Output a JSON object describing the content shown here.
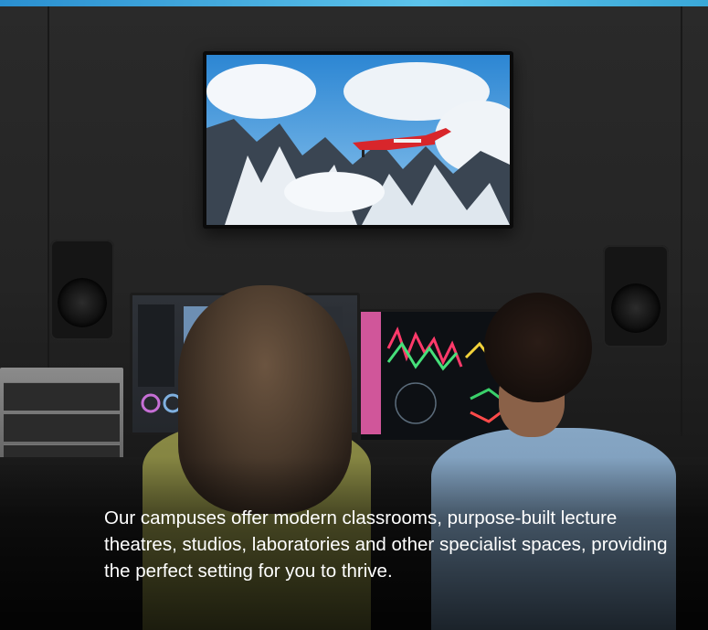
{
  "caption": {
    "text": "Our campuses offer modern classrooms, purpose-built lecture theatres, studios, laboratories and other specialist spaces, providing the perfect setting for you to thrive."
  },
  "colors": {
    "caption_text": "#ffffff",
    "top_strip": "#3aa8d8",
    "wall": "#242424",
    "sky": "#2f8ed8",
    "plane": "#d8262b"
  },
  "icons": {
    "top_strip": "accent-bar",
    "tv": "television-screen",
    "speakers": "studio-monitor-speaker",
    "monitors": "computer-monitor"
  }
}
